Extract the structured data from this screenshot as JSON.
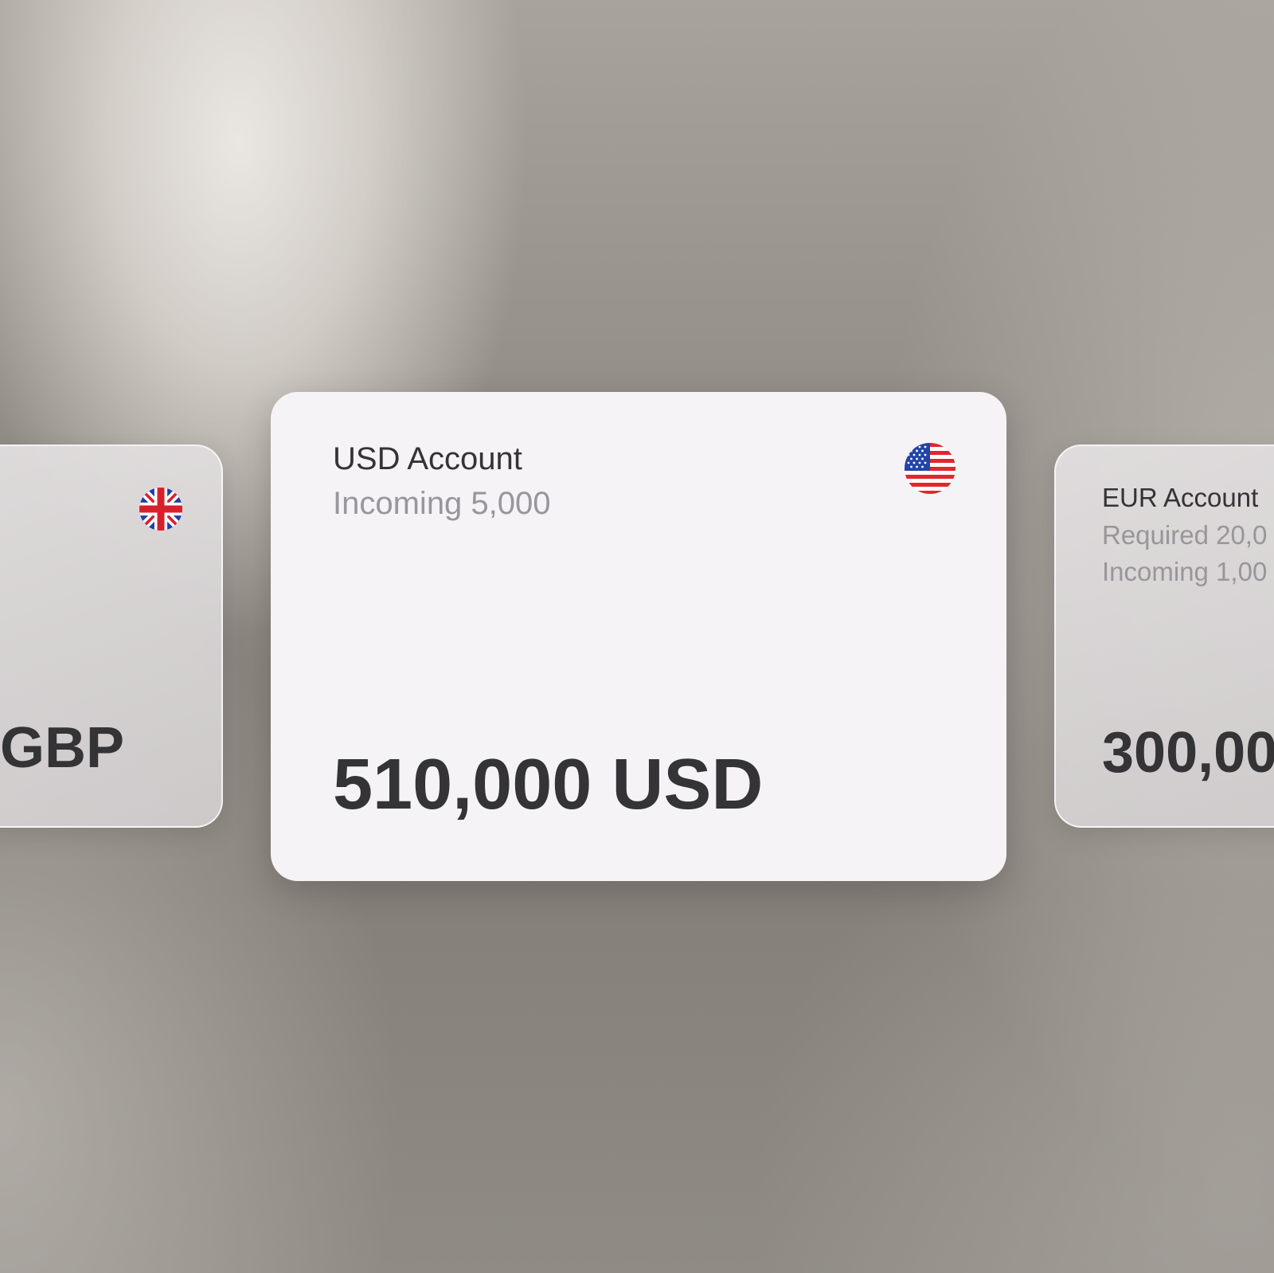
{
  "accounts": {
    "gbp": {
      "balance": "GBP",
      "flag_icon": "uk-flag-icon"
    },
    "usd": {
      "title": "USD Account",
      "incoming": "Incoming 5,000",
      "balance": "510,000 USD",
      "flag_icon": "us-flag-icon"
    },
    "eur": {
      "title": "EUR Account",
      "required": "Required 20,0",
      "incoming": "Incoming 1,00",
      "balance": "300,00"
    }
  },
  "colors": {
    "card_main_bg": "#f5f3f6",
    "text_primary": "#343336",
    "text_secondary": "#98969a"
  }
}
